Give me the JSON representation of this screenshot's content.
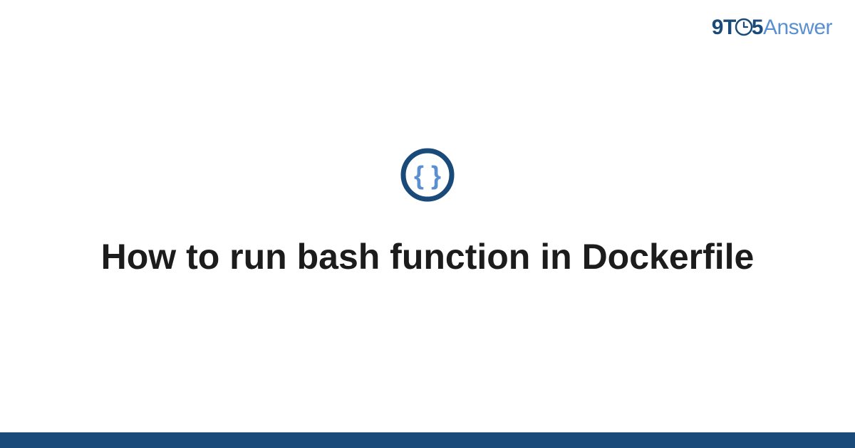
{
  "brand": {
    "prefix_9": "9",
    "prefix_T": "T",
    "prefix_5": "5",
    "suffix": "Answer"
  },
  "icon": {
    "name": "code-braces-icon"
  },
  "article": {
    "title": "How to run bash function in Dockerfile"
  },
  "colors": {
    "brand_dark": "#1a4a7a",
    "brand_light": "#5a8fd0",
    "text": "#1c1c1c",
    "footer": "#1a4a7a"
  }
}
